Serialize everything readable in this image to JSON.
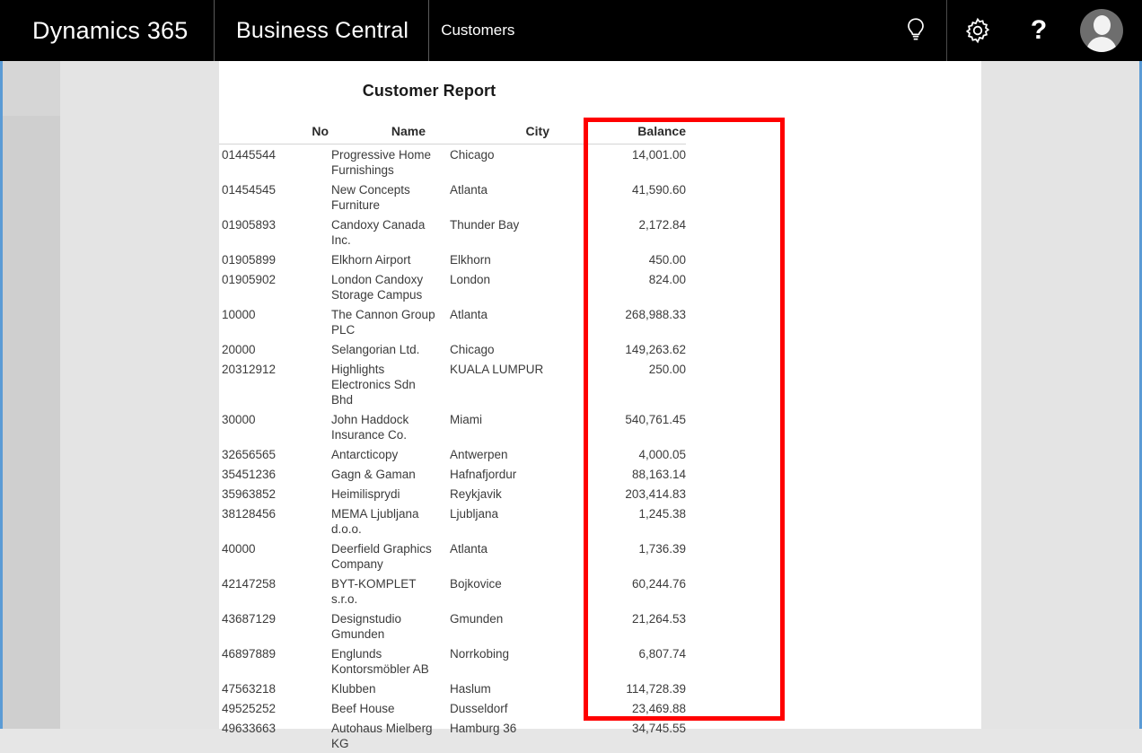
{
  "appbar": {
    "brand_primary": "Dynamics 365",
    "brand_secondary": "Business Central",
    "page_context": "Customers",
    "icons": {
      "tell_me": "lightbulb-icon",
      "settings": "gear-icon",
      "help": "?",
      "account": "avatar-icon"
    },
    "background_color": "#000000",
    "text_color": "#ffffff"
  },
  "annotation": {
    "type": "highlight-rectangle",
    "color": "#ff0000",
    "target_column": "Balance"
  },
  "report": {
    "title": "Customer Report",
    "columns": [
      {
        "key": "no",
        "label": "No"
      },
      {
        "key": "name",
        "label": "Name"
      },
      {
        "key": "city",
        "label": "City"
      },
      {
        "key": "balance",
        "label": "Balance"
      }
    ],
    "rows": [
      {
        "no": "01445544",
        "name": "Progressive Home Furnishings",
        "city": "Chicago",
        "balance": "14,001.00"
      },
      {
        "no": "01454545",
        "name": "New Concepts Furniture",
        "city": "Atlanta",
        "balance": "41,590.60"
      },
      {
        "no": "01905893",
        "name": "Candoxy Canada Inc.",
        "city": "Thunder Bay",
        "balance": "2,172.84"
      },
      {
        "no": "01905899",
        "name": "Elkhorn Airport",
        "city": "Elkhorn",
        "balance": "450.00"
      },
      {
        "no": "01905902",
        "name": "London Candoxy Storage Campus",
        "city": "London",
        "balance": "824.00"
      },
      {
        "no": "10000",
        "name": "The Cannon Group PLC",
        "city": "Atlanta",
        "balance": "268,988.33"
      },
      {
        "no": "20000",
        "name": "Selangorian Ltd.",
        "city": "Chicago",
        "balance": "149,263.62"
      },
      {
        "no": "20312912",
        "name": "Highlights Electronics Sdn Bhd",
        "city": "KUALA LUMPUR",
        "balance": "250.00"
      },
      {
        "no": "30000",
        "name": "John Haddock Insurance Co.",
        "city": "Miami",
        "balance": "540,761.45"
      },
      {
        "no": "32656565",
        "name": "Antarcticopy",
        "city": "Antwerpen",
        "balance": "4,000.05"
      },
      {
        "no": "35451236",
        "name": "Gagn & Gaman",
        "city": "Hafnafjordur",
        "balance": "88,163.14"
      },
      {
        "no": "35963852",
        "name": "Heimilisprydi",
        "city": "Reykjavik",
        "balance": "203,414.83"
      },
      {
        "no": "38128456",
        "name": "MEMA Ljubljana d.o.o.",
        "city": "Ljubljana",
        "balance": "1,245.38"
      },
      {
        "no": "40000",
        "name": "Deerfield Graphics Company",
        "city": "Atlanta",
        "balance": "1,736.39"
      },
      {
        "no": "42147258",
        "name": "BYT-KOMPLET s.r.o.",
        "city": "Bojkovice",
        "balance": "60,244.76"
      },
      {
        "no": "43687129",
        "name": "Designstudio Gmunden",
        "city": "Gmunden",
        "balance": "21,264.53"
      },
      {
        "no": "46897889",
        "name": "Englunds Kontorsmöbler AB",
        "city": "Norrkobing",
        "balance": "6,807.74"
      },
      {
        "no": "47563218",
        "name": "Klubben",
        "city": "Haslum",
        "balance": "114,728.39"
      },
      {
        "no": "49525252",
        "name": "Beef House",
        "city": "Dusseldorf",
        "balance": "23,469.88"
      },
      {
        "no": "49633663",
        "name": "Autohaus Mielberg KG",
        "city": "Hamburg 36",
        "balance": "34,745.55"
      }
    ]
  }
}
